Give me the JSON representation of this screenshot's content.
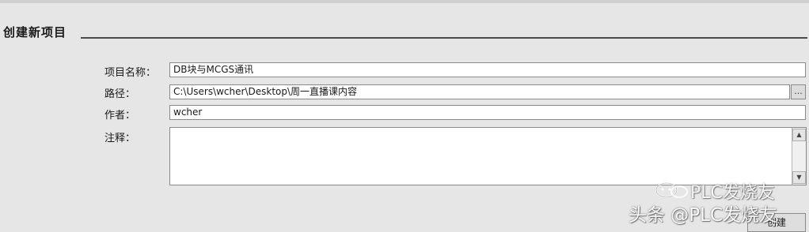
{
  "section": {
    "title": "创建新项目"
  },
  "form": {
    "name_label": "项目名称：",
    "name_value": "DB块与MCGS通讯",
    "path_label": "路径：",
    "path_value": "C:\\Users\\wcher\\Desktop\\周一直播课内容",
    "browse_label": "...",
    "author_label": "作者：",
    "author_value": "wcher",
    "comment_label": "注释：",
    "comment_value": ""
  },
  "scrollbar": {
    "up_arrow": "▲",
    "down_arrow": "▼"
  },
  "footer": {
    "create_button_label": "创建"
  },
  "watermark": {
    "line1": "PLC发烧友",
    "line2": "头条 @PLC发烧友"
  },
  "colors": {
    "background": "#e6e6e6",
    "field_background": "#ffffff",
    "field_border": "#8a8a8a",
    "rule": "#4a4a4a"
  }
}
